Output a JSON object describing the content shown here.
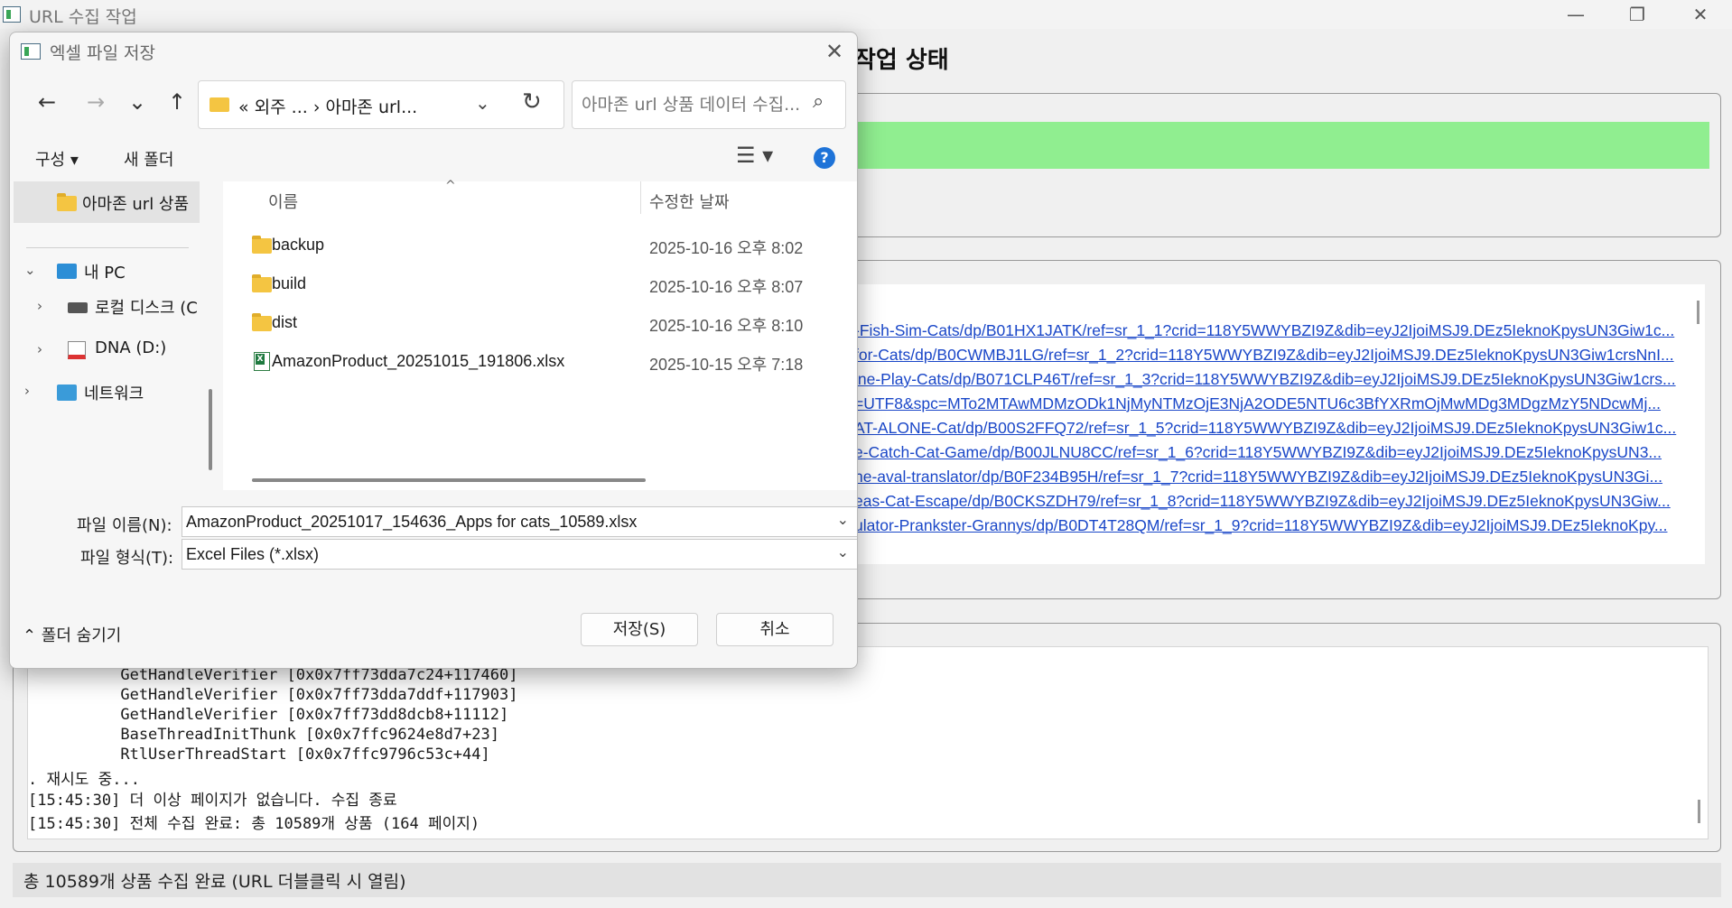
{
  "window": {
    "title": "URL 수집 작업",
    "minimize": "—",
    "maximize": "❐",
    "close": "✕"
  },
  "section_heading": "작업 상태",
  "progress": {
    "fraction": 1.0,
    "color": "#90ee90"
  },
  "url_rows": [
    "-Fish-Sim-Cats/dp/B01HX1JATK/ref=sr_1_1?crid=118Y5WWYBZI9Z&dib=eyJ2IjoiMSJ9.DEz5IeknoKpysUN3Giw1c...",
    "for-Cats/dp/B0CWMBJ1LG/ref=sr_1_2?crid=118Y5WWYBZI9Z&dib=eyJ2IjoiMSJ9.DEz5IeknoKpysUN3Giw1crsNnI...",
    "ine-Play-Cats/dp/B071CLP46T/ref=sr_1_3?crid=118Y5WWYBZI9Z&dib=eyJ2IjoiMSJ9.DEz5IeknoKpysUN3Giw1crs...",
    "=UTF8&spc=MTo2MTAwMDMzODk1NjMyNTMzOjE3NjA2ODE5NTU6c3BfYXRmOjMwMDg3MDgzMzY5NDcwMj...",
    "AT-ALONE-Cat/dp/B00S2FFQ72/ref=sr_1_5?crid=118Y5WWYBZI9Z&dib=eyJ2IjoiMSJ9.DEz5IeknoKpysUN3Giw1c...",
    "e-Catch-Cat-Game/dp/B00JLNU8CC/ref=sr_1_6?crid=118Y5WWYBZI9Z&dib=eyJ2IjoiMSJ9.DEz5IeknoKpysUN3...",
    "ne-aval-translator/dp/B0F234B95H/ref=sr_1_7?crid=118Y5WWYBZI9Z&dib=eyJ2IjoiMSJ9.DEz5IeknoKpysUN3Gi...",
    "eas-Cat-Escape/dp/B0CKSZDH79/ref=sr_1_8?crid=118Y5WWYBZI9Z&dib=eyJ2IjoiMSJ9.DEz5IeknoKpysUN3Giw...",
    "ulator-Prankster-Grannys/dp/B0DT4T28QM/ref=sr_1_9?crid=118Y5WWYBZI9Z&dib=eyJ2IjoiMSJ9.DEz5IeknoKpy..."
  ],
  "log_lines": [
    "          GetHandleVerifier [0x0x7ff73dda7c24+117460]",
    "          GetHandleVerifier [0x0x7ff73dda7ddf+117903]",
    "          GetHandleVerifier [0x0x7ff73dd8dcb8+11112]",
    "          BaseThreadInitThunk [0x0x7ffc9624e8d7+23]",
    "          RtlUserThreadStart [0x0x7ffc9796c53c+44]",
    ". 재시도 중...",
    "[15:45:30] 더 이상 페이지가 없습니다. 수집 종료",
    "[15:45:30] 전체 수집 완료: 총 10589개 상품 (164 페이지)"
  ],
  "status_bar": "총 10589개 상품 수집 완료 (URL 더블클릭 시 열림)",
  "dialog": {
    "title": "엑셀 파일 저장",
    "close": "✕",
    "nav": {
      "back": "←",
      "forward": "→",
      "recent": "⌄",
      "up": "↑"
    },
    "address": "« 외주 ...  ›  아마존 url...",
    "address_dropdown": "⌄",
    "refresh": "↻",
    "search_placeholder": "아마존 url 상품 데이터 수집...",
    "search_icon": "⌕",
    "toolbar": {
      "organize": "구성 ▾",
      "new_folder": "새 폴더",
      "view": "☰ ▾",
      "help": "?"
    },
    "nav_pane": {
      "selected": "아마존 url 상품",
      "items": [
        {
          "chevron": "⌄",
          "label": "내 PC"
        },
        {
          "chevron": "›",
          "label": "로컬 디스크 (C"
        },
        {
          "chevron": "›",
          "label": "DNA (D:)"
        },
        {
          "chevron": "›",
          "label": "네트워크"
        }
      ]
    },
    "columns": {
      "name": "이름",
      "modified": "수정한 날짜",
      "sort_indicator": "^"
    },
    "files": [
      {
        "name": "backup",
        "date": "2025-10-16 오후 8:02",
        "type": "folder"
      },
      {
        "name": "build",
        "date": "2025-10-16 오후 8:07",
        "type": "folder"
      },
      {
        "name": "dist",
        "date": "2025-10-16 오후 8:10",
        "type": "folder"
      },
      {
        "name": "AmazonProduct_20251015_191806.xlsx",
        "date": "2025-10-15 오후 7:18",
        "type": "xlsx"
      }
    ],
    "file_name_label": "파일 이름(N):",
    "file_name_value": "AmazonProduct_20251017_154636_Apps for cats_10589.xlsx",
    "file_type_label": "파일 형식(T):",
    "file_type_value": "Excel Files (*.xlsx)",
    "combo_arrow": "⌄",
    "hide_folders": "⌃ 폴더 숨기기",
    "save_button": "저장(S)",
    "cancel_button": "취소"
  }
}
